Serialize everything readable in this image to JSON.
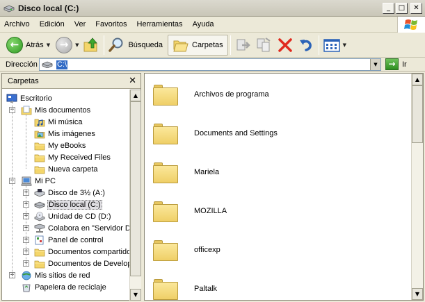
{
  "window": {
    "title": "Disco local (C:)"
  },
  "window_buttons": {
    "minimize": "_",
    "maximize": "□",
    "close": "✕"
  },
  "menu": [
    "Archivo",
    "Edición",
    "Ver",
    "Favoritos",
    "Herramientas",
    "Ayuda"
  ],
  "toolbar": {
    "back_label": "Atrás",
    "search_label": "Búsqueda",
    "folders_label": "Carpetas"
  },
  "address": {
    "label": "Dirección",
    "value": "C:\\",
    "go_label": "Ir"
  },
  "folder_pane": {
    "title": "Carpetas",
    "close_glyph": "✕",
    "tree": [
      {
        "label": "Escritorio",
        "icon": "desktop-icon",
        "level": 0,
        "expander": ""
      },
      {
        "label": "Mis documentos",
        "icon": "my-documents-icon",
        "level": 1,
        "expander": "−"
      },
      {
        "label": "Mi música",
        "icon": "music-folder-icon",
        "level": 2,
        "expander": ""
      },
      {
        "label": "Mis imágenes",
        "icon": "pictures-folder-icon",
        "level": 2,
        "expander": ""
      },
      {
        "label": "My eBooks",
        "icon": "folder-icon",
        "level": 2,
        "expander": ""
      },
      {
        "label": "My Received Files",
        "icon": "folder-icon",
        "level": 2,
        "expander": ""
      },
      {
        "label": "Nueva carpeta",
        "icon": "folder-icon",
        "level": 2,
        "expander": ""
      },
      {
        "label": "Mi PC",
        "icon": "my-computer-icon",
        "level": 1,
        "expander": "−"
      },
      {
        "label": "Disco de 3½ (A:)",
        "icon": "floppy-drive-icon",
        "level": 2,
        "expander": "+"
      },
      {
        "label": "Disco local (C:)",
        "icon": "hard-drive-icon",
        "level": 2,
        "expander": "+",
        "selected": true
      },
      {
        "label": "Unidad de CD (D:)",
        "icon": "cd-drive-icon",
        "level": 2,
        "expander": "+"
      },
      {
        "label": "Colabora en \"Servidor Da",
        "icon": "network-drive-icon",
        "level": 2,
        "expander": "+"
      },
      {
        "label": "Panel de control",
        "icon": "control-panel-icon",
        "level": 2,
        "expander": "+"
      },
      {
        "label": "Documentos compartidos",
        "icon": "folder-icon",
        "level": 2,
        "expander": "+"
      },
      {
        "label": "Documentos de Develope",
        "icon": "folder-icon",
        "level": 2,
        "expander": "+"
      },
      {
        "label": "Mis sitios de red",
        "icon": "network-places-icon",
        "level": 1,
        "expander": "+"
      },
      {
        "label": "Papelera de reciclaje",
        "icon": "recycle-bin-icon",
        "level": 1,
        "expander": ""
      }
    ]
  },
  "files": [
    {
      "name": "Archivos de programa"
    },
    {
      "name": "Documents and Settings"
    },
    {
      "name": "Mariela"
    },
    {
      "name": "MOZILLA"
    },
    {
      "name": "officexp"
    },
    {
      "name": "Paltalk"
    }
  ],
  "scroll_glyphs": {
    "up": "▲",
    "down": "▼"
  },
  "colors": {
    "selection": "#316ac5",
    "folder": "#efcf67",
    "back_green": "#2f9a22"
  }
}
